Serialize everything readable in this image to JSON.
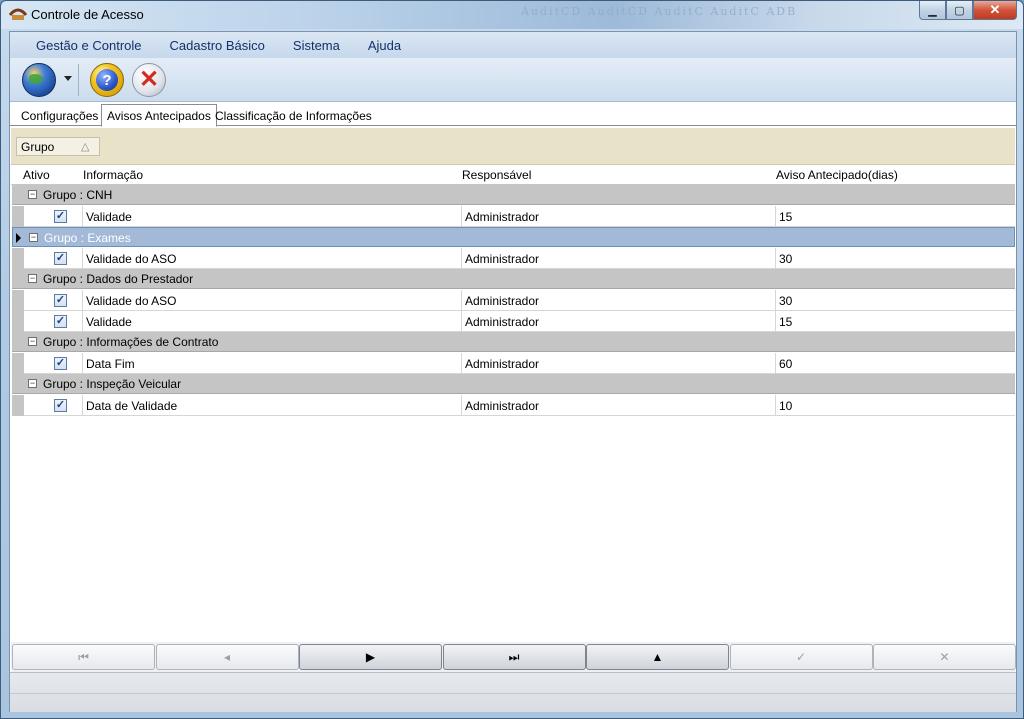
{
  "window": {
    "title": "Controle de Acesso",
    "decor_text": "AuditCD  AuditCD  AuditC  AuditC  ADB"
  },
  "menu": [
    "Gestão e Controle",
    "Cadastro Básico",
    "Sistema",
    "Ajuda"
  ],
  "toolbar": {
    "icons": [
      "globe-icon",
      "help-icon",
      "exit-icon"
    ]
  },
  "tabs": [
    "Configurações",
    "Avisos Antecipados",
    "Classificação de Informações"
  ],
  "active_tab": 1,
  "group_panel": {
    "chip_label": "Grupo",
    "sort_glyph": "△"
  },
  "columns": [
    "Ativo",
    "Informação",
    "Responsável",
    "Aviso Antecipado(dias)"
  ],
  "groups": [
    {
      "label": "Grupo : CNH",
      "selected": false,
      "rows": [
        {
          "checked": true,
          "info": "Validade",
          "resp": "Administrador",
          "dias": "15"
        }
      ]
    },
    {
      "label": "Grupo : Exames",
      "selected": true,
      "rows": [
        {
          "checked": true,
          "info": "Validade do ASO",
          "resp": "Administrador",
          "dias": "30"
        }
      ]
    },
    {
      "label": "Grupo : Dados do Prestador",
      "selected": false,
      "rows": [
        {
          "checked": true,
          "info": "Validade do ASO",
          "resp": "Administrador",
          "dias": "30"
        },
        {
          "checked": true,
          "info": "Validade",
          "resp": "Administrador",
          "dias": "15"
        }
      ]
    },
    {
      "label": "Grupo : Informações de Contrato",
      "selected": false,
      "rows": [
        {
          "checked": true,
          "info": "Data Fim",
          "resp": "Administrador",
          "dias": "60"
        }
      ]
    },
    {
      "label": "Grupo : Inspeção Veicular",
      "selected": false,
      "rows": [
        {
          "checked": true,
          "info": "Data de Validade",
          "resp": "Administrador",
          "dias": "10"
        }
      ]
    }
  ],
  "navigator": [
    {
      "name": "nav-first-button",
      "glyph": "⏮",
      "enabled": false
    },
    {
      "name": "nav-prev-button",
      "glyph": "◂",
      "enabled": false
    },
    {
      "name": "nav-next-button",
      "glyph": "▶",
      "enabled": true
    },
    {
      "name": "nav-last-button",
      "glyph": "⏭",
      "enabled": true
    },
    {
      "name": "nav-insert-button",
      "glyph": "▲",
      "enabled": true
    },
    {
      "name": "nav-post-button",
      "glyph": "✓",
      "enabled": false
    },
    {
      "name": "nav-cancel-button",
      "glyph": "✕",
      "enabled": false
    }
  ]
}
